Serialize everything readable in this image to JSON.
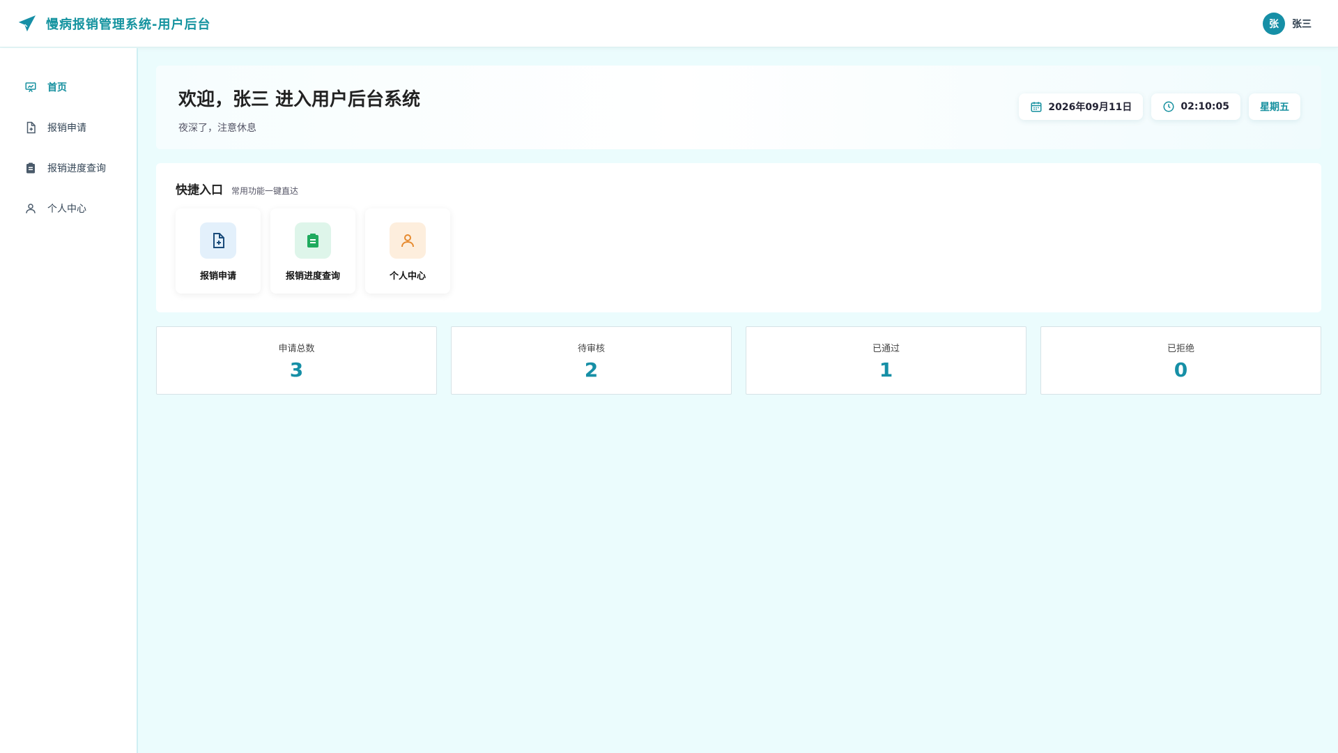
{
  "header": {
    "title": "慢病报销管理系统-用户后台",
    "logo_icon": "paper-plane-icon",
    "user": {
      "avatar_text": "张",
      "name": "张三"
    }
  },
  "sidebar": {
    "items": [
      {
        "label": "首页",
        "icon": "presentation-icon",
        "active": true
      },
      {
        "label": "报销申请",
        "icon": "file-plus-icon",
        "active": false
      },
      {
        "label": "报销进度查询",
        "icon": "clipboard-icon",
        "active": false
      },
      {
        "label": "个人中心",
        "icon": "user-icon",
        "active": false
      }
    ]
  },
  "welcome": {
    "title": "欢迎，张三 进入用户后台系统",
    "subtitle": "夜深了，注意休息",
    "date": "2026年09月11日",
    "time": "02:10:05",
    "weekday": "星期五"
  },
  "quick": {
    "title": "快捷入口",
    "subtitle": "常用功能一键直达",
    "cards": [
      {
        "label": "报销申请",
        "icon": "file-plus-icon",
        "color": "#1a4b7a"
      },
      {
        "label": "报销进度查询",
        "icon": "clipboard-icon",
        "color": "#1faa5e"
      },
      {
        "label": "个人中心",
        "icon": "user-icon",
        "color": "#e68a2e"
      }
    ]
  },
  "stats": [
    {
      "label": "申请总数",
      "value": "3"
    },
    {
      "label": "待审核",
      "value": "2"
    },
    {
      "label": "已通过",
      "value": "1"
    },
    {
      "label": "已拒绝",
      "value": "0"
    }
  ],
  "colors": {
    "accent": "#16909f",
    "background": "#ebfcfd"
  }
}
